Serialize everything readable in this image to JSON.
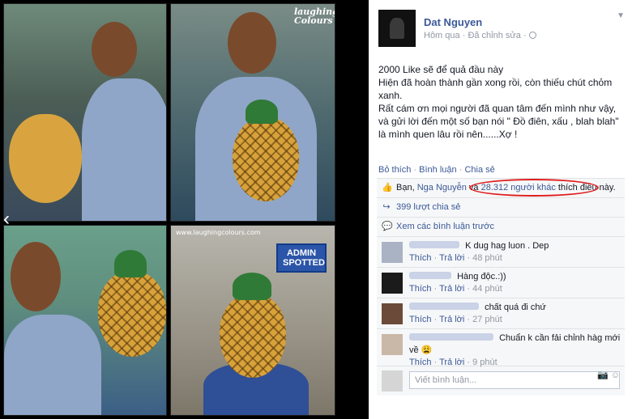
{
  "photo": {
    "watermark_top": "laughing Colours",
    "watermark_bottom": "www.laughingcolours.com",
    "badge": "ADMIN SPOTTED"
  },
  "post": {
    "author": "Dat Nguyen",
    "time": "Hôm qua",
    "edited": "Đã chỉnh sửa",
    "lines": [
      "2000 Like sẽ để quả đầu này",
      "Hiện đã hoàn thành gần xong rồi, còn thiếu chút chỏm xanh.",
      "Rất cám ơn mọi người đã quan tâm đến mình như vậy, và gửi lời đến một số bạn nói \" Đồ điên, xấu , blah blah\" là mình quen lâu rồi nên......Xợ !"
    ],
    "actions": {
      "like": "Bỏ thích",
      "comment": "Bình luận",
      "share": "Chia sẻ"
    },
    "likes": {
      "prefix": "Bạn,",
      "friend": "Nga Nguyễn",
      "connector": "và",
      "others": "28.312 người khác",
      "suffix": "thích điều này."
    },
    "shares": "399 lượt chia sẻ",
    "view_previous": "Xem các bình luận trước",
    "comments": [
      {
        "text": "K dug hag luon . Dep",
        "like": "Thích",
        "reply": "Trả lời",
        "time": "48 phút",
        "name_width": 62
      },
      {
        "text": "Hàng độc.:))",
        "like": "Thích",
        "reply": "Trả lời",
        "time": "44 phút",
        "name_width": 52
      },
      {
        "text": "chất quá đi chứ",
        "like": "Thích",
        "reply": "Trả lời",
        "time": "27 phút",
        "name_width": 86
      },
      {
        "text": "Chuẩn k cần fải chỉnh hàg mới về",
        "like": "Thích",
        "reply": "Trả lời",
        "time": "9 phút",
        "name_width": 104,
        "emoji": "😩"
      }
    ],
    "write_placeholder": "Viết bình luận...",
    "icons": [
      "globe-icon",
      "like-thumb-icon",
      "share-icon",
      "comment-bubble-icon",
      "camera-icon",
      "emoticon-icon",
      "chevron-left-icon"
    ],
    "colors": {
      "link": "#3b5998",
      "meta": "#9197a3",
      "highlight": "#e01b1b"
    }
  }
}
